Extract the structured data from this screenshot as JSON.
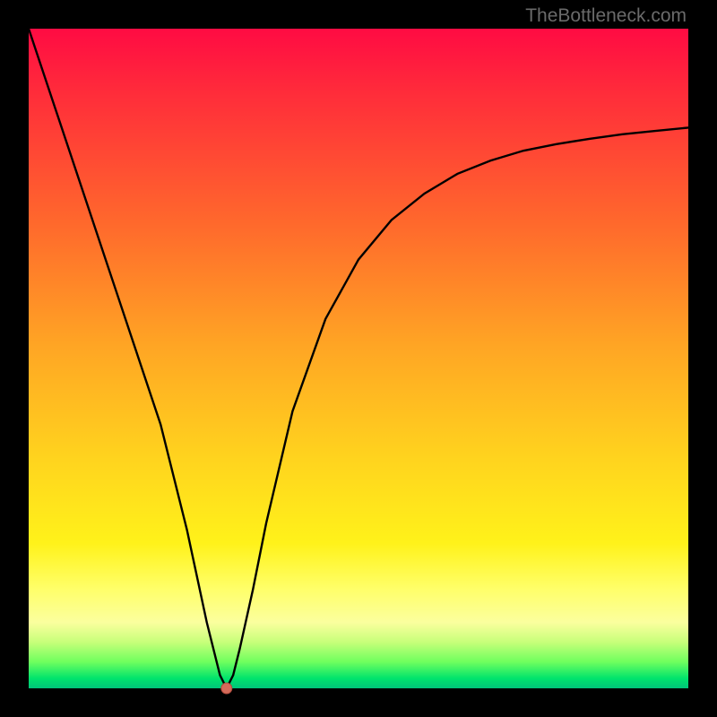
{
  "watermark": "TheBottleneck.com",
  "chart_data": {
    "type": "line",
    "title": "",
    "xlabel": "",
    "ylabel": "",
    "xlim": [
      0,
      100
    ],
    "ylim": [
      0,
      100
    ],
    "grid": false,
    "legend": false,
    "background_gradient": {
      "stops": [
        {
          "pos": 0,
          "color": "#ff0b43"
        },
        {
          "pos": 0.3,
          "color": "#ff6a2c"
        },
        {
          "pos": 0.65,
          "color": "#ffd31e"
        },
        {
          "pos": 0.85,
          "color": "#ffff6a"
        },
        {
          "pos": 0.96,
          "color": "#6fff5e"
        },
        {
          "pos": 1.0,
          "color": "#00c47a"
        }
      ]
    },
    "series": [
      {
        "name": "curve",
        "x": [
          0,
          4,
          8,
          12,
          16,
          20,
          24,
          27,
          29,
          30,
          31,
          32,
          34,
          36,
          40,
          45,
          50,
          55,
          60,
          65,
          70,
          75,
          80,
          85,
          90,
          95,
          100
        ],
        "y": [
          100,
          88,
          76,
          64,
          52,
          40,
          24,
          10,
          2,
          0,
          2,
          6,
          15,
          25,
          42,
          56,
          65,
          71,
          75,
          78,
          80,
          81.5,
          82.5,
          83.3,
          84,
          84.5,
          85
        ]
      }
    ],
    "marker": {
      "x": 30,
      "y": 0,
      "color": "#d46a5a",
      "r": 6
    }
  }
}
